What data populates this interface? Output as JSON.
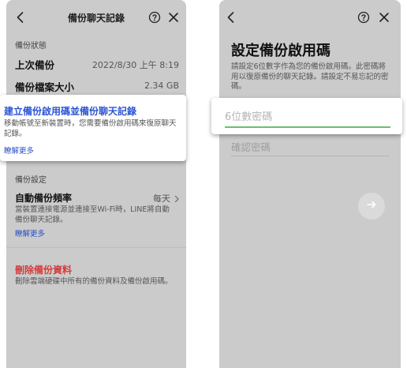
{
  "left_screen": {
    "header": {
      "title": "備份聊天記錄"
    },
    "backup_status": {
      "section_title": "備份狀態",
      "last_backup": {
        "label": "上次備份",
        "value": "2022/8/30 上午 8:19"
      },
      "file_size": {
        "label": "備份檔案大小",
        "value": "2.34 GB"
      }
    },
    "pin_card": {
      "title": "建立備份啟用碼並備份聊天記錄",
      "description": "移動帳號至新裝置時，您需要備份啟用碼來復原聊天記錄。",
      "link": "瞭解更多"
    },
    "backup_settings": {
      "section_title": "備份設定",
      "frequency": {
        "label": "自動備份頻率",
        "value": "每天",
        "description": "當裝置連接電源並連接至Wi-Fi時，LINE將自動備份聊天記錄。",
        "link": "瞭解更多"
      }
    },
    "delete": {
      "label": "刪除備份資料",
      "description": "刪除雲端硬碟中所有的備份資料及備份啟用碼。"
    }
  },
  "right_screen": {
    "title": "設定備份啟用碼",
    "description": "請設定6位數字作為您的備份啟用碼。此密碼將用以復原備份的聊天記錄。請設定不易忘記的密碼。",
    "pin_input": {
      "placeholder": "6位數密碼",
      "value": ""
    },
    "confirm_input": {
      "placeholder": "確認密碼",
      "value": ""
    }
  },
  "icons": {
    "back": "chevron-left-icon",
    "help": "question-circle-icon",
    "close": "close-icon",
    "next": "arrow-right-icon",
    "chevron": "chevron-right-icon"
  },
  "colors": {
    "screen_bg": "#cbcbcb",
    "card_bg": "#ffffff",
    "accent_blue": "#2b54d6",
    "danger_red": "#d63a3a",
    "input_focus_green": "#6cbf73"
  }
}
